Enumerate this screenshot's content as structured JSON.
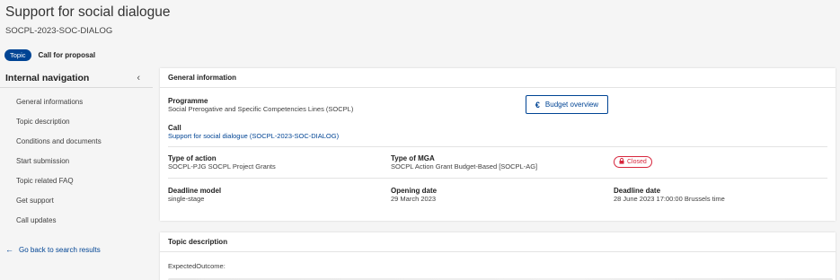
{
  "page": {
    "title": "Support for social dialogue",
    "code": "SOCPL-2023-SOC-DIALOG",
    "topic_badge": "Topic",
    "call_type": "Call for proposal"
  },
  "sidebar": {
    "title": "Internal navigation",
    "collapse_icon": "‹",
    "items": [
      {
        "label": "General informations"
      },
      {
        "label": "Topic description"
      },
      {
        "label": "Conditions and documents"
      },
      {
        "label": "Start submission"
      },
      {
        "label": "Topic related FAQ"
      },
      {
        "label": "Get support"
      },
      {
        "label": "Call updates"
      }
    ],
    "back_link": "Go back to search results",
    "back_icon": "←"
  },
  "general_info": {
    "header": "General information",
    "programme_label": "Programme",
    "programme_value": "Social Prerogative and Specific Competencies Lines (SOCPL)",
    "budget_button": "Budget overview",
    "budget_icon": "€",
    "call_label": "Call",
    "call_value": "Support for social dialogue (SOCPL-2023-SOC-DIALOG)",
    "type_action_label": "Type of action",
    "type_action_value": "SOCPL-PJG SOCPL Project Grants",
    "type_mga_label": "Type of MGA",
    "type_mga_value": "SOCPL Action Grant Budget-Based [SOCPL-AG]",
    "status": "Closed",
    "deadline_model_label": "Deadline model",
    "deadline_model_value": "single-stage",
    "opening_date_label": "Opening date",
    "opening_date_value": "29 March 2023",
    "deadline_date_label": "Deadline date",
    "deadline_date_value": "28 June 2023 17:00:00 Brussels time"
  },
  "topic_description": {
    "header": "Topic description",
    "expected_outcome": "ExpectedOutcome:"
  },
  "colors": {
    "accent": "#004494",
    "closed": "#d7263d",
    "background": "#f5f5f5"
  }
}
